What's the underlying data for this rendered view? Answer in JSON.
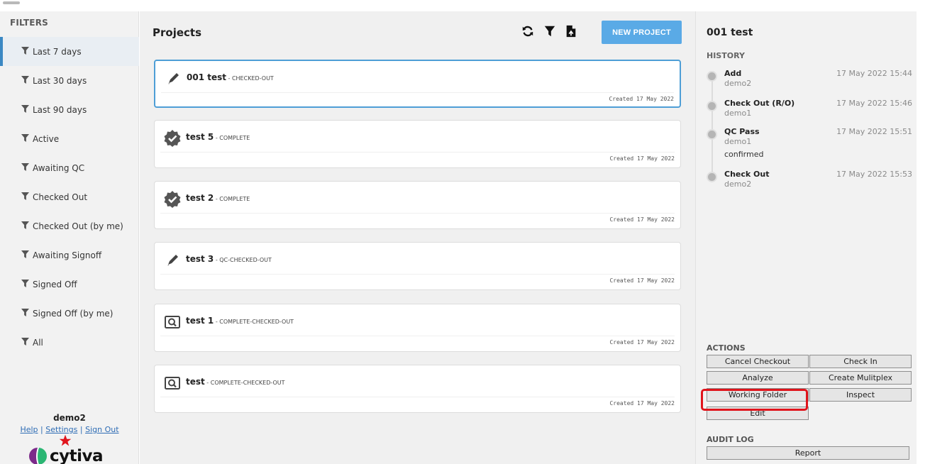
{
  "sidebar": {
    "filters_title": "FILTERS",
    "items": [
      {
        "label": "Last 7 days",
        "active": true
      },
      {
        "label": "Last 30 days",
        "active": false
      },
      {
        "label": "Last 90 days",
        "active": false
      },
      {
        "label": "Active",
        "active": false
      },
      {
        "label": "Awaiting QC",
        "active": false
      },
      {
        "label": "Checked Out",
        "active": false
      },
      {
        "label": "Checked Out (by me)",
        "active": false
      },
      {
        "label": "Awaiting Signoff",
        "active": false
      },
      {
        "label": "Signed Off",
        "active": false
      },
      {
        "label": "Signed Off (by me)",
        "active": false
      },
      {
        "label": "All",
        "active": false
      }
    ],
    "username": "demo2",
    "links": {
      "help": "Help",
      "settings": "Settings",
      "sign_out": "Sign Out",
      "separator": "|"
    },
    "logo_text": "cytiva"
  },
  "projects": {
    "title": "Projects",
    "new_project_label": "NEW PROJECT",
    "toolbar_icons": [
      "refresh-icon",
      "filter-icon",
      "export-file-icon"
    ],
    "cards": [
      {
        "name": "001 test",
        "status": " - CHECKED-OUT",
        "created": "Created 17 May 2022",
        "icon": "pencil-icon",
        "selected": true
      },
      {
        "name": "test 5",
        "status": " - COMPLETE",
        "created": "Created 17 May 2022",
        "icon": "verified-badge-icon",
        "selected": false
      },
      {
        "name": "test 2",
        "status": " - COMPLETE",
        "created": "Created 17 May 2022",
        "icon": "verified-badge-icon",
        "selected": false
      },
      {
        "name": "test 3",
        "status": " - QC-CHECKED-OUT",
        "created": "Created 17 May 2022",
        "icon": "pencil-icon",
        "selected": false
      },
      {
        "name": "test 1",
        "status": " - COMPLETE-CHECKED-OUT",
        "created": "Created 17 May 2022",
        "icon": "magnifier-box-icon",
        "selected": false
      },
      {
        "name": "test",
        "status": " - COMPLETE-CHECKED-OUT",
        "created": "Created 17 May 2022",
        "icon": "magnifier-box-icon",
        "selected": false
      }
    ]
  },
  "detail": {
    "title": "001 test",
    "history_label": "HISTORY",
    "history": [
      {
        "action": "Add",
        "user": "demo2",
        "time": "17 May 2022 15:44",
        "comment": ""
      },
      {
        "action": "Check Out (R/O)",
        "user": "demo1",
        "time": "17 May 2022 15:46",
        "comment": ""
      },
      {
        "action": "QC Pass",
        "user": "demo1",
        "time": "17 May 2022 15:51",
        "comment": "confirmed"
      },
      {
        "action": "Check Out",
        "user": "demo2",
        "time": "17 May 2022 15:53",
        "comment": ""
      }
    ],
    "actions_label": "ACTIONS",
    "actions": {
      "cancel_checkout": "Cancel Checkout",
      "check_in": "Check In",
      "analyze": "Analyze",
      "create_multiplex": "Create Mulitplex",
      "working_folder": "Working Folder",
      "inspect": "Inspect",
      "edit": "Edit"
    },
    "audit_label": "AUDIT LOG",
    "report_label": "Report"
  },
  "colors": {
    "accent": "#5aaae6",
    "selected_border": "#4e9ed6",
    "highlight": "#e0141c",
    "link": "#2f6db5"
  }
}
